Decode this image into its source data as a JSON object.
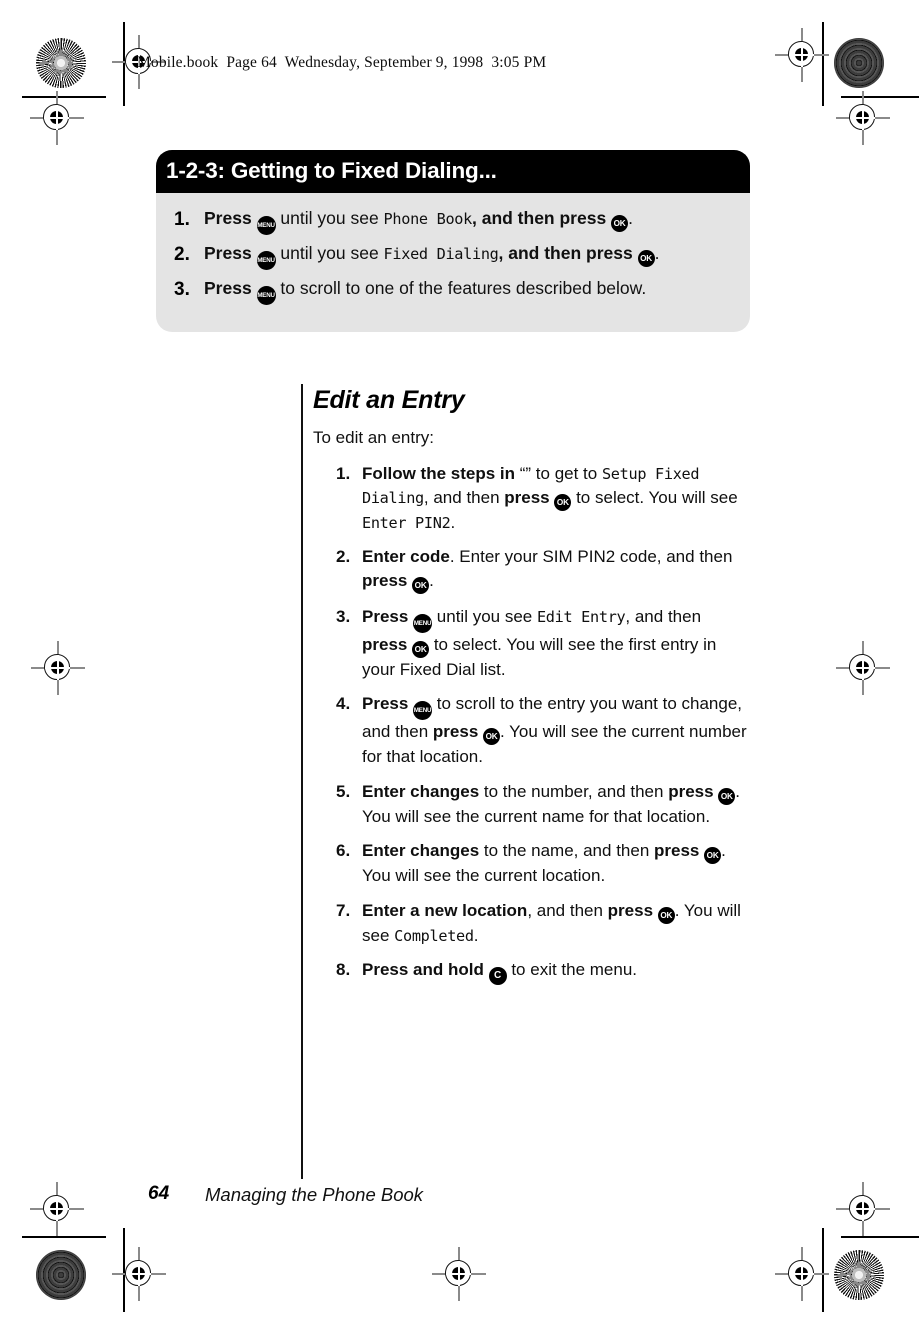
{
  "doc": {
    "header_line": "Mobile.book  Page 64  Wednesday, September 9, 1998  3:05 PM",
    "page_number": "64",
    "footer_title": "Managing the Phone Book"
  },
  "callout": {
    "title": "1-2-3: Getting to Fixed Dialing...",
    "steps": [
      {
        "num": "1.",
        "lead": "Press",
        "mid": " until you see ",
        "device": "Phone Book",
        "tail_bold": ", and then press",
        "end": "."
      },
      {
        "num": "2.",
        "lead": "Press",
        "mid": " until you see ",
        "device": "Fixed Dialing",
        "tail_bold": ", and then press",
        "end": "."
      },
      {
        "num": "3.",
        "lead": "Press",
        "mid": " to scroll to one of the features described below."
      }
    ]
  },
  "section": {
    "heading": "Edit an Entry",
    "intro": "To edit an entry:"
  },
  "steps": [
    {
      "num": "1.",
      "lead": "Follow the steps in",
      "quote": "“”",
      "t1": " to get to ",
      "device1": "Setup Fixed Dialing",
      "t2": ", and then ",
      "bold2": "press",
      "t3": " to select. You will see ",
      "device2": "Enter PIN2",
      "t4": "."
    },
    {
      "num": "2.",
      "lead": "Enter code",
      "t1": ". Enter your SIM PIN2 code, and then ",
      "bold2": "press",
      "t4": "."
    },
    {
      "num": "3.",
      "lead": "Press",
      "t1": " until you see ",
      "device1": "Edit Entry",
      "t2": ", and then ",
      "bold2": "press",
      "t3": " to select. You will see the first entry in your Fixed Dial list."
    },
    {
      "num": "4.",
      "lead": "Press",
      "t1": " to scroll to the entry you want to change, and then ",
      "bold2": "press",
      "t3": ". You will see the current number for that location."
    },
    {
      "num": "5.",
      "lead": "Enter changes",
      "t1": " to the number, and then ",
      "bold2": "press",
      "t3": ". You will see the current name for that location."
    },
    {
      "num": "6.",
      "lead": "Enter changes",
      "t1": " to the name, and then ",
      "bold2": "press",
      "t3": ". You will see the current location."
    },
    {
      "num": "7.",
      "lead": "Enter a new location",
      "t1": ", and then ",
      "bold2": "press",
      "t3": ". You will see ",
      "device2": "Completed",
      "t4": "."
    },
    {
      "num": "8.",
      "lead": "Press and hold",
      "t3": " to exit the menu."
    }
  ],
  "keys": {
    "menu": "MENU",
    "ok": "OK",
    "clear": "C"
  }
}
